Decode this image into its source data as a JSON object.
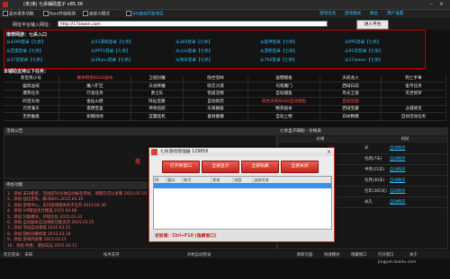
{
  "window": {
    "title": "(未)未| 七杀辅助盒子 v85.36"
  },
  "toolbar": {
    "opt1": "显示更多功能",
    "opt2": "Ban/外挂检测",
    "opt3": "自定义模式",
    "opt4": "QQ自动开放专区",
    "menu": [
      "游戏任务",
      "游戏模式",
      "群主",
      "用户设置"
    ]
  },
  "address": {
    "label": "网址平台输入网址:",
    "value": "http://17aiwan.com",
    "go": "进入平台"
  },
  "links": {
    "header": "推荐网游：七杀入口",
    "items": [
      [
        "从4399登录【七杀】",
        "从51游戏登录【七杀】",
        "从360登录【七杀】",
        "从超神登录【七杀】",
        "从PPS登录【七杀】"
      ],
      [
        "从百度登录【七杀】",
        "从PPTV登录【七杀】",
        "从火山登录【七杀】",
        "从游民登录【七杀】",
        "从91玩登录【七杀】"
      ],
      [
        "从37玩登录【七杀】",
        "从49you登录【七杀】",
        "从快乐登录【七杀】",
        "从766登录【七杀】",
        "从17aiwan【七杀】"
      ]
    ]
  },
  "games": {
    "title": "本辅助支持以下任务：",
    "rows": [
      [
        "新区练小号",
        "赛季物资BOSS副本",
        "卫道封魔",
        "隐世羽林",
        "送镖模板",
        "天机龙火",
        "死亡手事"
      ],
      [
        "幽冥血域",
        "魔八旷区",
        "天龙降魔",
        "晓芯沙漠",
        "司南魔门",
        "西域日前",
        "金币任务"
      ],
      [
        "爆弊任务",
        "行会任务",
        "勇士队",
        "悟道活物",
        "自动捕鱼",
        "月光卫道",
        "灭世修罗"
      ],
      [
        "四宝天地",
        "金仙山壁",
        "阵仙宝册",
        "自动炼药",
        "四色天地BOSS自动捕鱼",
        "自动答题",
        ""
      ],
      [
        "元宵满天",
        "夜明宝盒",
        "神骨追踪",
        "天将群殿",
        "精英副本",
        "西域宝藏",
        "占城修灵"
      ],
      [
        "无所推级",
        "如钢闯地",
        "宜蕾挂机",
        "喜财搬赚",
        "自动上物",
        "白杖精模",
        "自动活动任务"
      ]
    ]
  },
  "notice": {
    "header": "活动公告",
    "mark": "无"
  },
  "news": {
    "header": "待办功能",
    "items": [
      "1、添加 末日使者，活动前50分钟自动报名参加，周期在可以查看 2015.05.10",
      "2、添加 强化定制，解决BUG 2015.04.30",
      "3、添加 游戏中心，支持游戏相关的子任务 2015.04.30",
      "4、添加 VIP赠送金元赠送 2015.04.08",
      "5、添加 功能模块，持续优化 2015.03.31",
      "6、添加 自动副本自动领取功能支持 2015.03.25",
      "7、添加 活动自动领取 2015.03.25",
      "8、添加 随机剑阁修复 2015.03.18",
      "9、添加 游戏内查看 2015.03.11",
      "10、添加 改善，增加日志 2015.03.11"
    ]
  },
  "vip": {
    "header": "七杀盒子辅助 - 价格表",
    "cols": [
      "价格",
      "时间"
    ],
    "rows": [
      {
        "price": "3元",
        "duration": "天",
        "buy": "自动购买"
      },
      {
        "price": "8元",
        "duration": "包周(7天)",
        "buy": "自动购买"
      },
      {
        "price": "15元",
        "duration": "半月(15天)",
        "buy": "自动购买"
      },
      {
        "price": "25元",
        "duration": "包月(30天)",
        "buy": "自动购买"
      },
      {
        "price": "100元",
        "duration": "包年(365天)",
        "buy": "自动购买"
      },
      {
        "price": "180元",
        "duration": "永久",
        "buy": "自动购买"
      }
    ]
  },
  "status": {
    "left1": "您已登录： 未知",
    "left2": "技术支持",
    "mid": "开始自动登录",
    "right": [
      "刷新页面",
      "快速模式",
      "隐藏窗口",
      "打开窗口",
      "关于"
    ]
  },
  "dialog": {
    "title": "七杀游戏管理器 129856",
    "buttons": [
      "打开新窗口",
      "全部显示",
      "全部隐藏",
      "全部关闭"
    ],
    "cols": [
      "ID",
      "窗口",
      "账号",
      "状态",
      "进度",
      "当前任务"
    ],
    "footer": "老板键：Ctrl+F10 (隐藏窗口)"
  },
  "watermark": "jingyan.baidu.com",
  "colors": {
    "link": "#2fc0ff",
    "accent": "#c0281f",
    "alert": "#ff3030"
  }
}
